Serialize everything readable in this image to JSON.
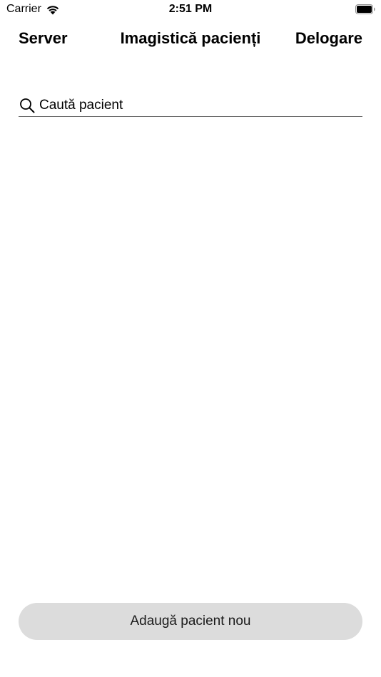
{
  "status_bar": {
    "carrier": "Carrier",
    "time": "2:51 PM",
    "icons": [
      "wifi-icon",
      "battery-icon"
    ]
  },
  "nav": {
    "left_label": "Server",
    "title": "Imagistică pacienți",
    "right_label": "Delogare"
  },
  "search": {
    "placeholder": "Caută pacient",
    "value": "",
    "icon": "search-icon"
  },
  "footer": {
    "add_label": "Adaugă pacient nou"
  },
  "colors": {
    "background": "#ffffff",
    "button_bg": "#dcdcdc",
    "underline": "#6b6b6b",
    "text": "#000000"
  }
}
